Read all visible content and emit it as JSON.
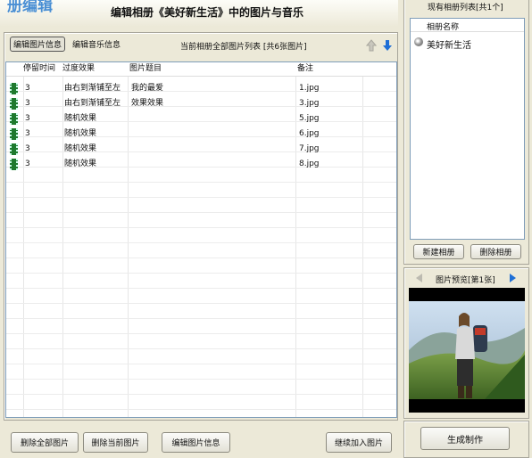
{
  "header": {
    "title_partial": "册编辑   ",
    "title": "编辑相册《美好新生活》中的图片与音乐"
  },
  "tabs": {
    "photo_info": "编辑图片信息",
    "music_info": "编辑音乐信息"
  },
  "photo_list_caption": "当前相册全部图片列表 [共6张图片]",
  "grid": {
    "columns": [
      "停留时间",
      "过度效果",
      "图片题目",
      "备注"
    ],
    "rows": [
      {
        "time": "3",
        "effect": "由右到渐铺至左",
        "title": "我的最爱",
        "note": "1.jpg"
      },
      {
        "time": "3",
        "effect": "由右到渐铺至左",
        "title": "效果效果",
        "note": "3.jpg"
      },
      {
        "time": "3",
        "effect": "随机效果",
        "title": "",
        "note": "5.jpg"
      },
      {
        "time": "3",
        "effect": "随机效果",
        "title": "",
        "note": "6.jpg"
      },
      {
        "time": "3",
        "effect": "随机效果",
        "title": "",
        "note": "7.jpg"
      },
      {
        "time": "3",
        "effect": "随机效果",
        "title": "",
        "note": "8.jpg"
      }
    ]
  },
  "bottom_buttons": {
    "delete_all": "删除全部图片",
    "delete_current": "删除当前图片",
    "edit_info": "编辑图片信息",
    "continue_add": "继续加入图片"
  },
  "album_panel": {
    "title": "现有相册列表[共1个]",
    "column": "相册名称",
    "albums": [
      "美好新生活"
    ],
    "new_button": "新建相册",
    "delete_button": "删除相册"
  },
  "preview": {
    "label": "图片预览[第1张]"
  },
  "generate_button": "生成制作",
  "colors": {
    "bg": "#ece9d8",
    "film": "#1e7a2e",
    "arrow_blue": "#1f6fd6"
  }
}
